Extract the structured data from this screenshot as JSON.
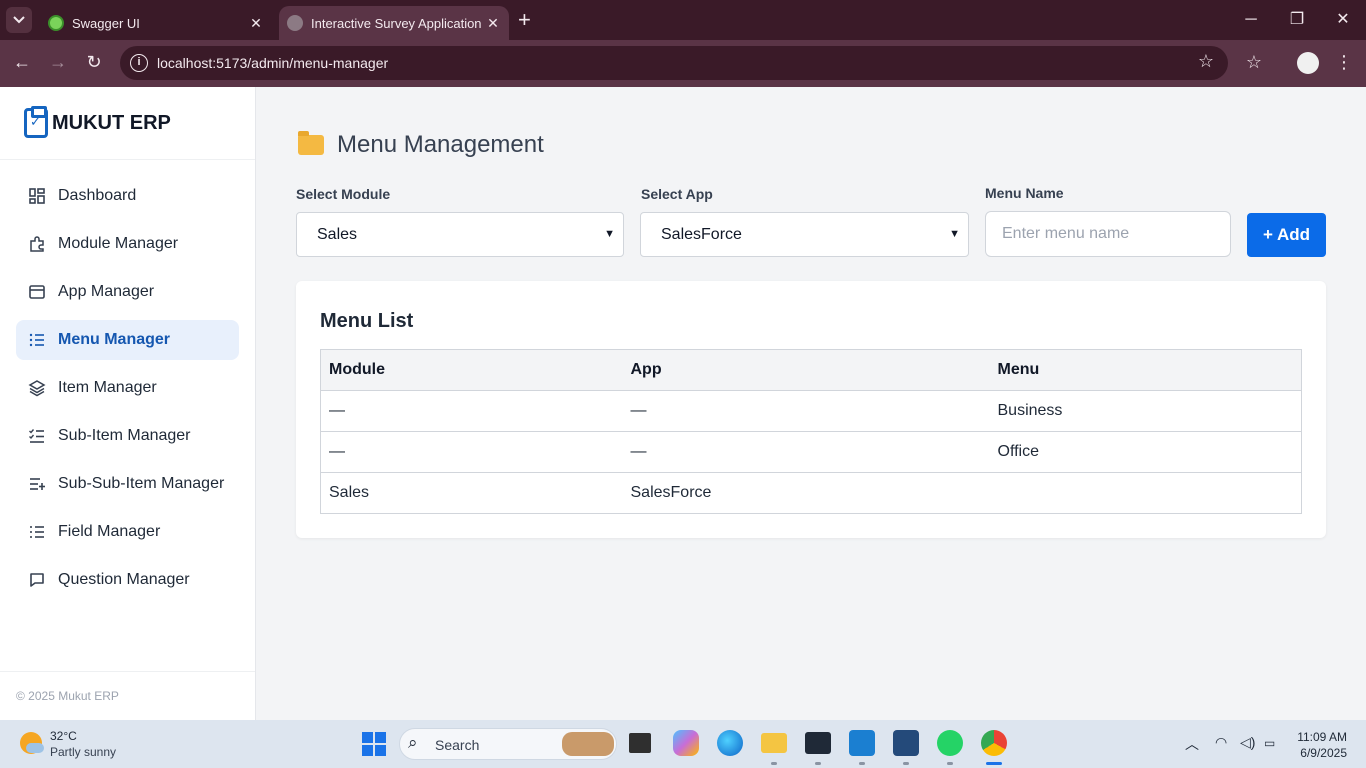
{
  "browser": {
    "tabs": [
      {
        "title": "Swagger UI"
      },
      {
        "title": "Interactive Survey Application w"
      }
    ],
    "url": "localhost:5173/admin/menu-manager"
  },
  "sidebar": {
    "brand": "MUKUT ERP",
    "items": [
      {
        "label": "Dashboard",
        "icon": "dashboard-icon"
      },
      {
        "label": "Module Manager",
        "icon": "puzzle-icon"
      },
      {
        "label": "App Manager",
        "icon": "window-icon"
      },
      {
        "label": "Menu Manager",
        "icon": "list-icon",
        "active": true
      },
      {
        "label": "Item Manager",
        "icon": "layers-icon"
      },
      {
        "label": "Sub-Item Manager",
        "icon": "checklist-icon"
      },
      {
        "label": "Sub-Sub-Item Manager",
        "icon": "list-add-icon"
      },
      {
        "label": "Field Manager",
        "icon": "list-ordered-icon"
      },
      {
        "label": "Question Manager",
        "icon": "message-square-icon"
      }
    ],
    "footer": "© 2025 Mukut ERP"
  },
  "main": {
    "title": "Menu Management",
    "form": {
      "module_label": "Select Module",
      "module_value": "Sales",
      "app_label": "Select App",
      "app_value": "SalesForce",
      "menu_label": "Menu Name",
      "menu_placeholder": "Enter menu name",
      "add_label": "+ Add"
    },
    "card": {
      "title": "Menu List",
      "columns": [
        "Module",
        "App",
        "Menu"
      ],
      "rows": [
        [
          "—",
          "—",
          "Business"
        ],
        [
          "—",
          "—",
          "Office"
        ],
        [
          "Sales",
          "SalesForce",
          ""
        ]
      ]
    }
  },
  "taskbar": {
    "temp": "32°C",
    "weather": "Partly sunny",
    "search_label": "Search",
    "time": "11:09 AM",
    "date": "6/9/2025"
  },
  "colors": {
    "accent": "#0b6be8",
    "active_bg": "#e8f0fc",
    "chrome": "#3a1a28"
  }
}
